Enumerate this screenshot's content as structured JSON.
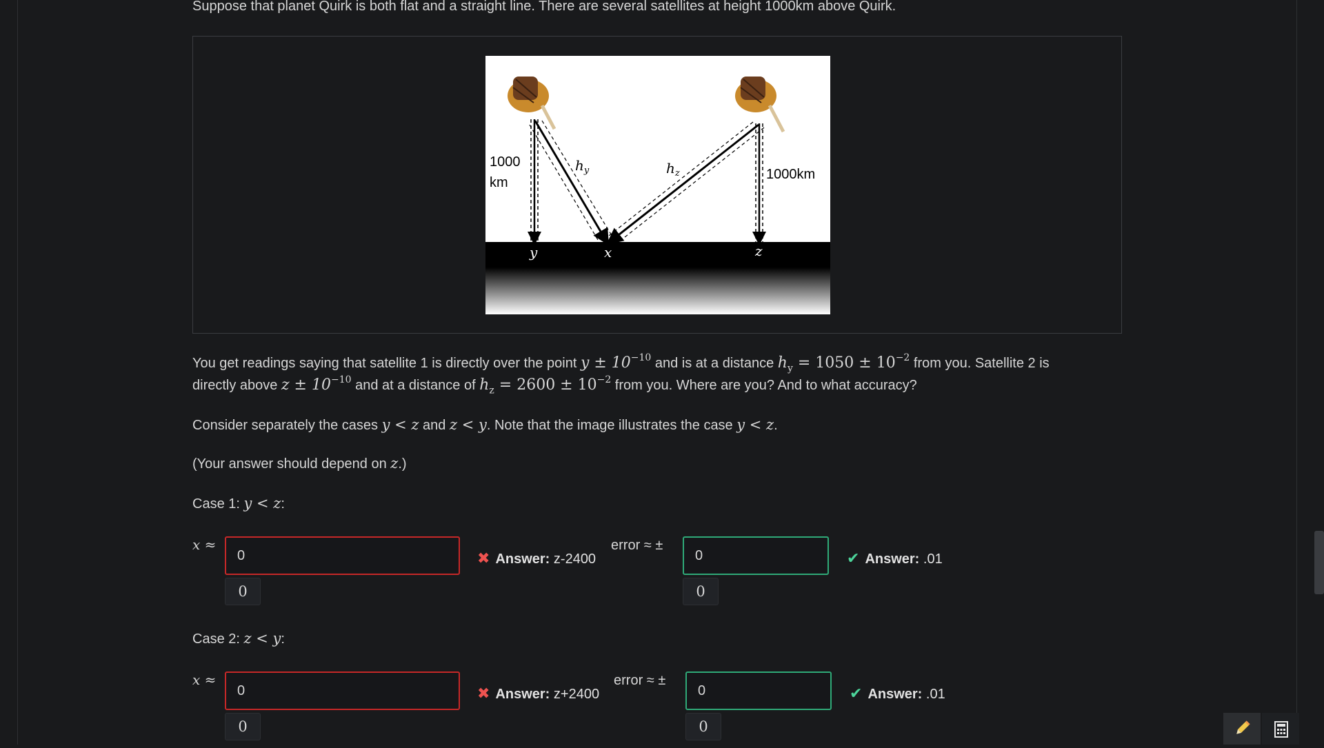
{
  "intro": "Suppose that planet Quirk is both flat and a straight line. There are several satellites at height 1000km above Quirk.",
  "figure": {
    "label_left_1": "1000",
    "label_left_2": "km",
    "label_right": "1000km",
    "label_hy": "h",
    "label_hy_sub": "y",
    "label_hz": "h",
    "label_hz_sub": "z",
    "label_y": "y",
    "label_x": "x",
    "label_z": "z"
  },
  "para1": {
    "t1": "You get readings saying that satellite 1 is directly over the point ",
    "m1": "y ± 10",
    "m1_sup": "−10",
    "t2": " and is at a distance ",
    "m2": "h",
    "m2_sub": "y",
    "m2b": " = 1050 ± 10",
    "m2_sup": "−2",
    "t3": " from you. Satellite 2 is",
    "t4": "directly above ",
    "m3": "z ± 10",
    "m3_sup": "−10",
    "t5": " and at a distance of ",
    "m4": "h",
    "m4_sub": "z",
    "m4b": " = 2600 ± 10",
    "m4_sup": "−2",
    "t6": " from you. Where are you? And to what accuracy?"
  },
  "para2": {
    "t1": "Consider separately the cases ",
    "m1": "y < z",
    "t2": " and ",
    "m2": "z < y",
    "t3": ". Note that the image illustrates the case ",
    "m3": "y < z",
    "t4": "."
  },
  "para3": {
    "t1": "(Your answer should depend on ",
    "m1": "z",
    "t2": ".)"
  },
  "cases": [
    {
      "label": "Case 1: ",
      "label_math": "y < z",
      "label_end": ":",
      "x_label": "x ≈",
      "x_value": "0",
      "x_preview": "0",
      "x_answer_label": "Answer:",
      "x_answer": "z-2400",
      "err_label": "error ≈ ±",
      "err_value": "0",
      "err_preview": "0",
      "err_answer_label": "Answer:",
      "err_answer": ".01"
    },
    {
      "label": "Case 2: ",
      "label_math": "z < y",
      "label_end": ":",
      "x_label": "x ≈",
      "x_value": "0",
      "x_preview": "0",
      "x_answer_label": "Answer:",
      "x_answer": "z+2400",
      "err_label": "error ≈ ±",
      "err_value": "0",
      "err_preview": "0",
      "err_answer_label": "Answer:",
      "err_answer": ".01"
    }
  ],
  "icons": {
    "pencil": "pencil-icon",
    "calculator": "calculator-icon"
  },
  "colors": {
    "error": "#c62828",
    "correct": "#2faa78",
    "background": "#191a1c"
  }
}
